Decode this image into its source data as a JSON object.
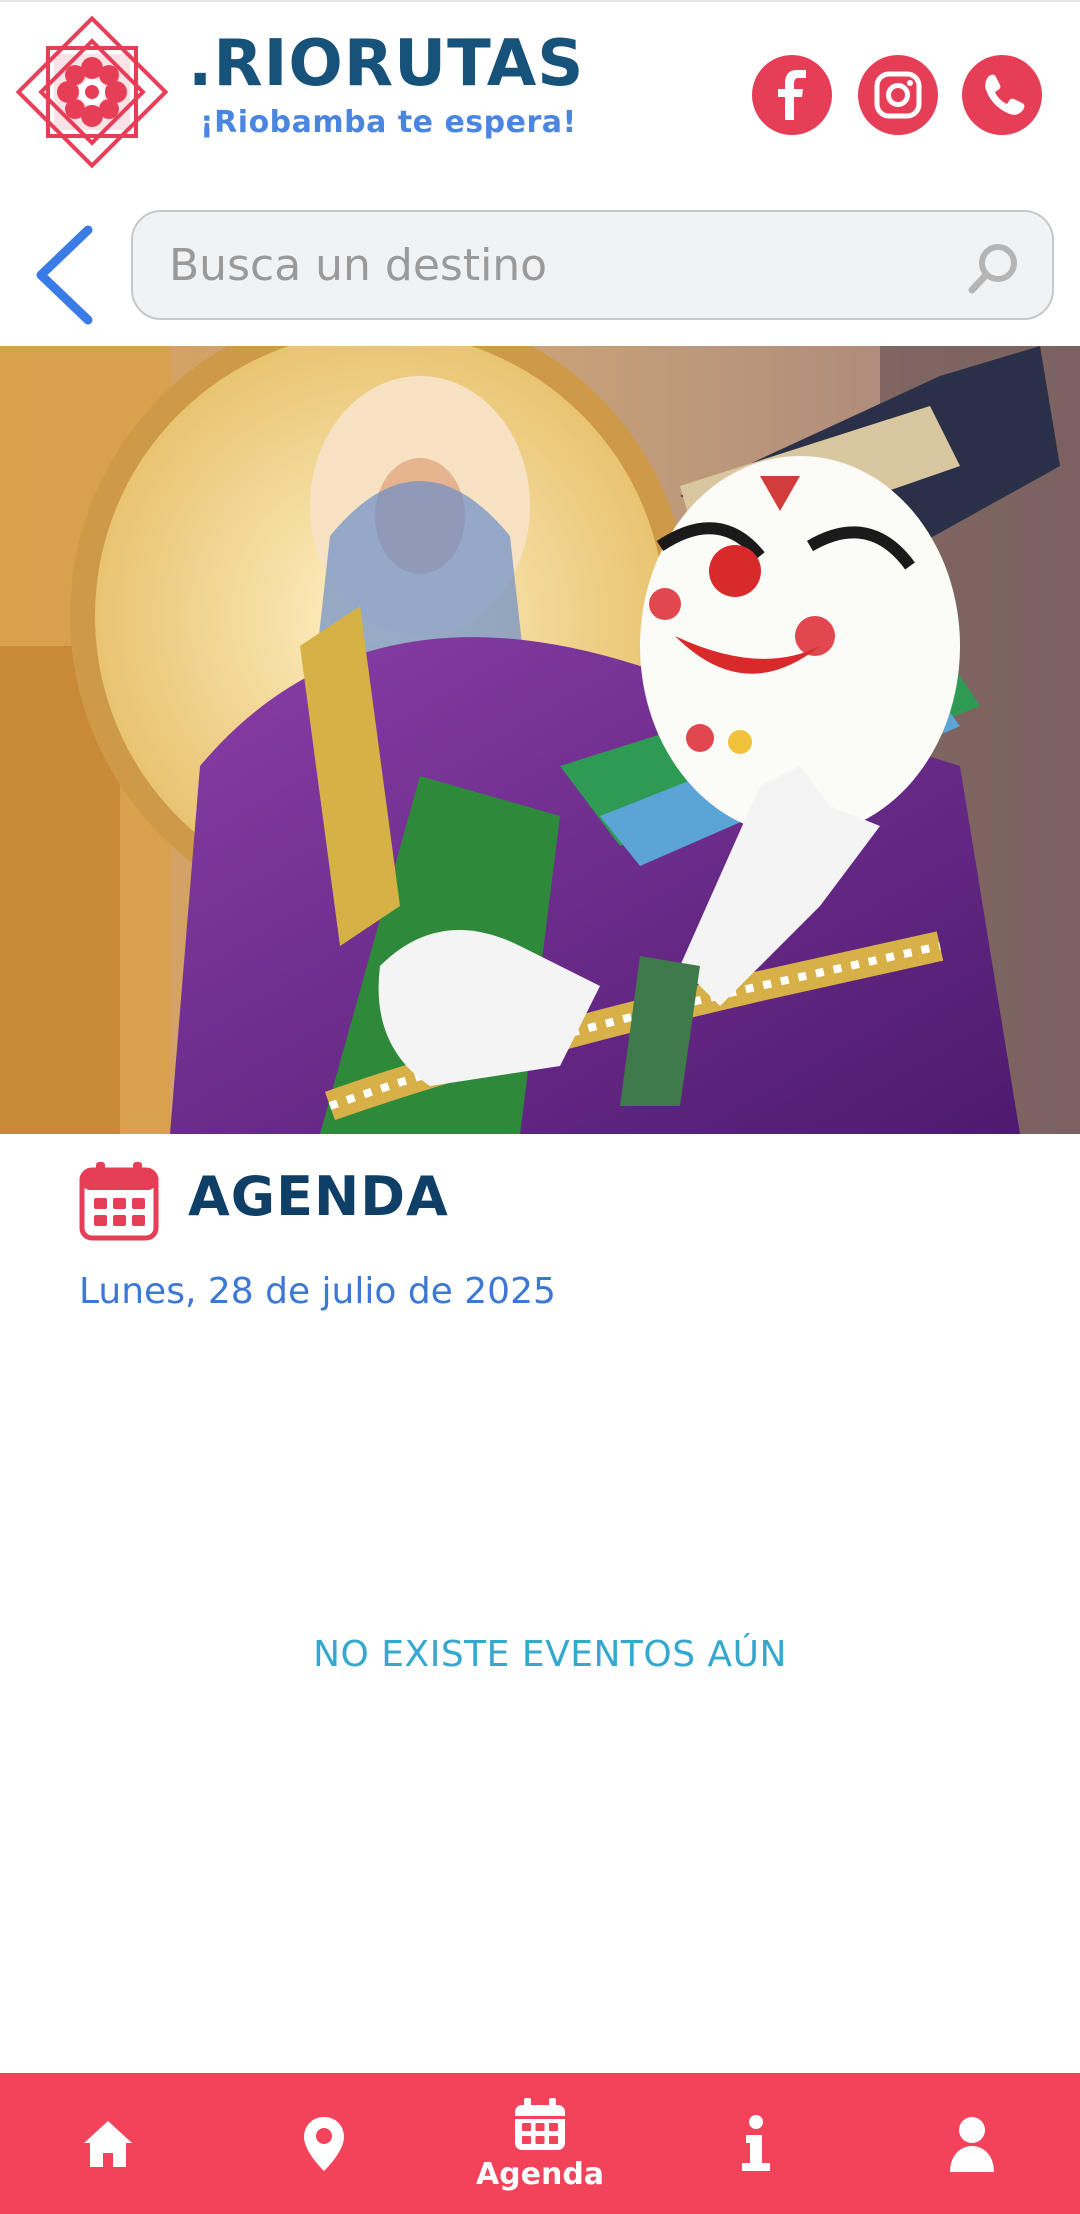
{
  "header": {
    "brand_name": ".RIORUTAS",
    "tagline": "¡Riobamba te espera!",
    "brand_color": "#e63e57",
    "social": [
      {
        "name": "facebook",
        "icon": "facebook-icon"
      },
      {
        "name": "instagram",
        "icon": "instagram-icon"
      },
      {
        "name": "whatsapp",
        "icon": "whatsapp-icon"
      }
    ]
  },
  "search": {
    "placeholder": "Busca un destino",
    "value": "",
    "icon": "search-icon"
  },
  "hero": {
    "icon": "hero-photo"
  },
  "agenda": {
    "title": "AGENDA",
    "date": "Lunes, 28 de julio de 2025",
    "empty_message": "NO EXISTE EVENTOS AÚN",
    "icon": "calendar-icon",
    "accent": "#3d78d6"
  },
  "bottom_nav": {
    "background": "#f2435a",
    "items": [
      {
        "id": "home",
        "icon": "home-icon",
        "label": ""
      },
      {
        "id": "map",
        "icon": "map-pin-icon",
        "label": ""
      },
      {
        "id": "agenda",
        "icon": "calendar-icon",
        "label": "Agenda",
        "active": true
      },
      {
        "id": "info",
        "icon": "info-icon",
        "label": ""
      },
      {
        "id": "user",
        "icon": "user-icon",
        "label": ""
      }
    ]
  }
}
